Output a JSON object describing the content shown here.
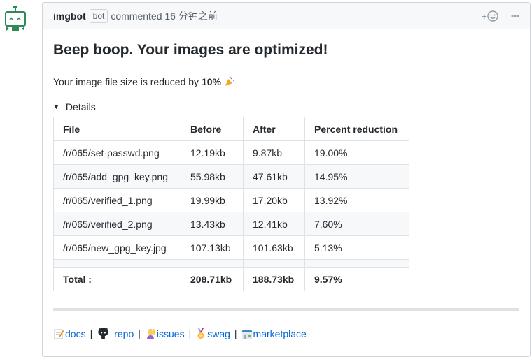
{
  "comment": {
    "author": "imgbot",
    "bot_label": "bot",
    "action": "commented 16 分钟之前"
  },
  "content": {
    "title": "Beep boop. Your images are optimized!",
    "message_prefix": "Your image file size is reduced by ",
    "message_percent": "10%",
    "details_label": "Details"
  },
  "table": {
    "headers": [
      "File",
      "Before",
      "After",
      "Percent reduction"
    ],
    "rows": [
      [
        "/r/065/set-passwd.png",
        "12.19kb",
        "9.87kb",
        "19.00%"
      ],
      [
        "/r/065/add_gpg_key.png",
        "55.98kb",
        "47.61kb",
        "14.95%"
      ],
      [
        "/r/065/verified_1.png",
        "19.99kb",
        "17.20kb",
        "13.92%"
      ],
      [
        "/r/065/verified_2.png",
        "13.43kb",
        "12.41kb",
        "7.60%"
      ],
      [
        "/r/065/new_gpg_key.jpg",
        "107.13kb",
        "101.63kb",
        "5.13%"
      ]
    ],
    "total": [
      "Total :",
      "208.71kb",
      "188.73kb",
      "9.57%"
    ]
  },
  "footer_links": {
    "docs": "docs",
    "repo": "repo",
    "issues": "issues",
    "swag": "swag",
    "marketplace": "marketplace",
    "separator": "|"
  },
  "icons": {
    "avatar": "imgbot-robot-avatar",
    "add_reaction": "smiley-add-icon",
    "more": "kebab-icon"
  },
  "colors": {
    "link": "#0366d6",
    "avatar": "#2e8b57"
  }
}
